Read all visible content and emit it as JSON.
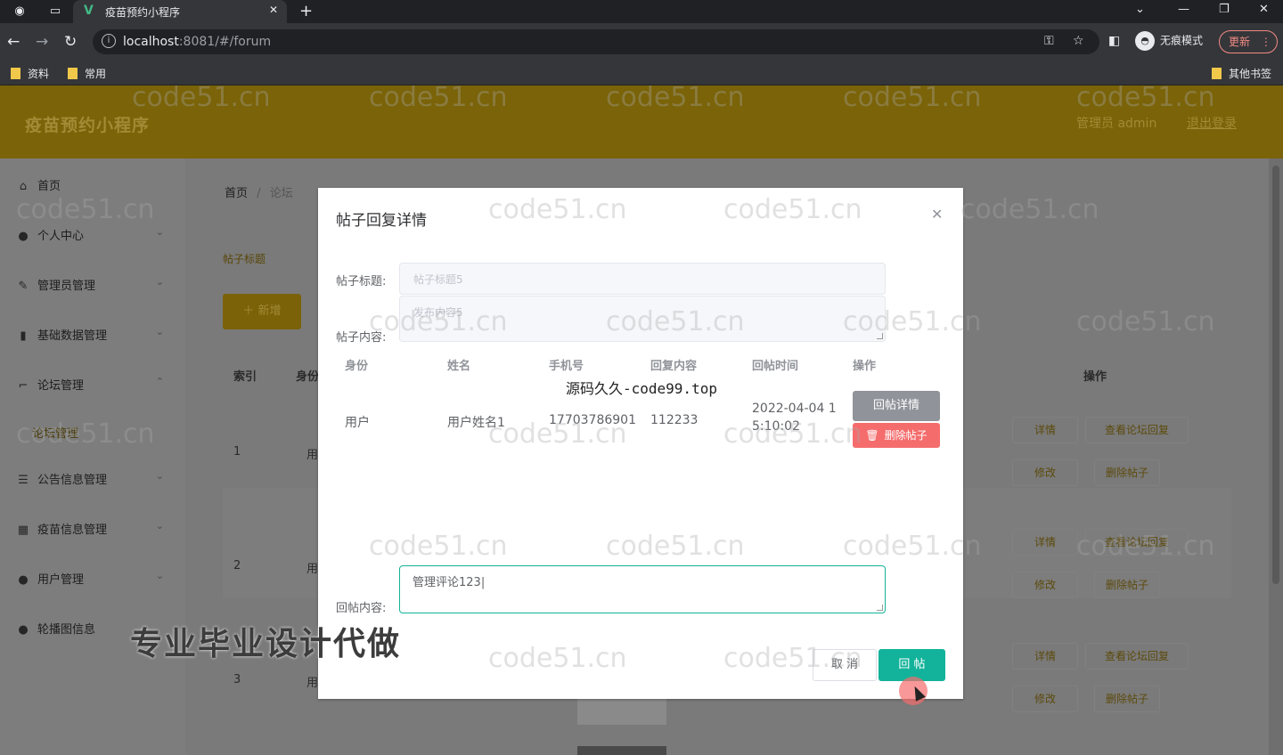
{
  "browser": {
    "tab_title": "疫苗预约小程序",
    "url_host": "localhost",
    "url_rest": ":8081/#/forum",
    "incognito_label": "无痕模式",
    "update_label": "更新",
    "bookmarks": [
      "资料",
      "常用"
    ],
    "other_bookmarks": "其他书签"
  },
  "header": {
    "brand": "疫苗预约小程序",
    "admin": "管理员 admin",
    "logout": "退出登录"
  },
  "sidebar": {
    "items": [
      {
        "label": "首页",
        "icon": "home-icon"
      },
      {
        "label": "个人中心",
        "icon": "user-icon"
      },
      {
        "label": "管理员管理",
        "icon": "edit-icon"
      },
      {
        "label": "基础数据管理",
        "icon": "bar-chart-icon"
      },
      {
        "label": "论坛管理",
        "icon": "crop-icon"
      },
      {
        "label": "公告信息管理",
        "icon": "list-icon"
      },
      {
        "label": "疫苗信息管理",
        "icon": "grid-icon"
      },
      {
        "label": "用户管理",
        "icon": "user-icon"
      },
      {
        "label": "轮播图信息",
        "icon": "user-icon"
      }
    ],
    "submenu": "论坛管理"
  },
  "page": {
    "breadcrumb": [
      "首页",
      "/",
      "论坛"
    ],
    "search_label": "帖子标题",
    "add_button": "＋ 新增",
    "columns": [
      "索引",
      "身份",
      "操作"
    ],
    "rows": [
      {
        "index": "1",
        "role": "用"
      },
      {
        "index": "2",
        "role": "用"
      },
      {
        "index": "3",
        "role": "用"
      }
    ],
    "row_actions": [
      "详情",
      "查看论坛回复",
      "修改",
      "删除帖子"
    ]
  },
  "dialog": {
    "title": "帖子回复详情",
    "title_label": "帖子标题:",
    "title_value": "帖子标题5",
    "content_label": "帖子内容:",
    "content_value": "发布内容5",
    "columns": [
      "身份",
      "姓名",
      "手机号",
      "回复内容",
      "回帖时间",
      "操作"
    ],
    "reply_row": {
      "role": "用户",
      "name": "用户姓名1",
      "phone": "17703786901",
      "content": "112233",
      "time_line1": "2022-04-04 1",
      "time_line2": "5:10:02"
    },
    "detail_button": "回帖详情",
    "delete_button": "删除帖子",
    "reply_label": "回帖内容:",
    "reply_value": "管理评论123",
    "cancel_button": "取 消",
    "submit_button": "回 帖",
    "source_note": "源码久久-code99.top"
  },
  "overlay_text": "专业毕业设计代做",
  "watermark": "code51.cn",
  "colors": {
    "accent": "#12b39a",
    "danger": "#f56c6c",
    "info": "#909399",
    "header_gold": "#7a6308"
  }
}
